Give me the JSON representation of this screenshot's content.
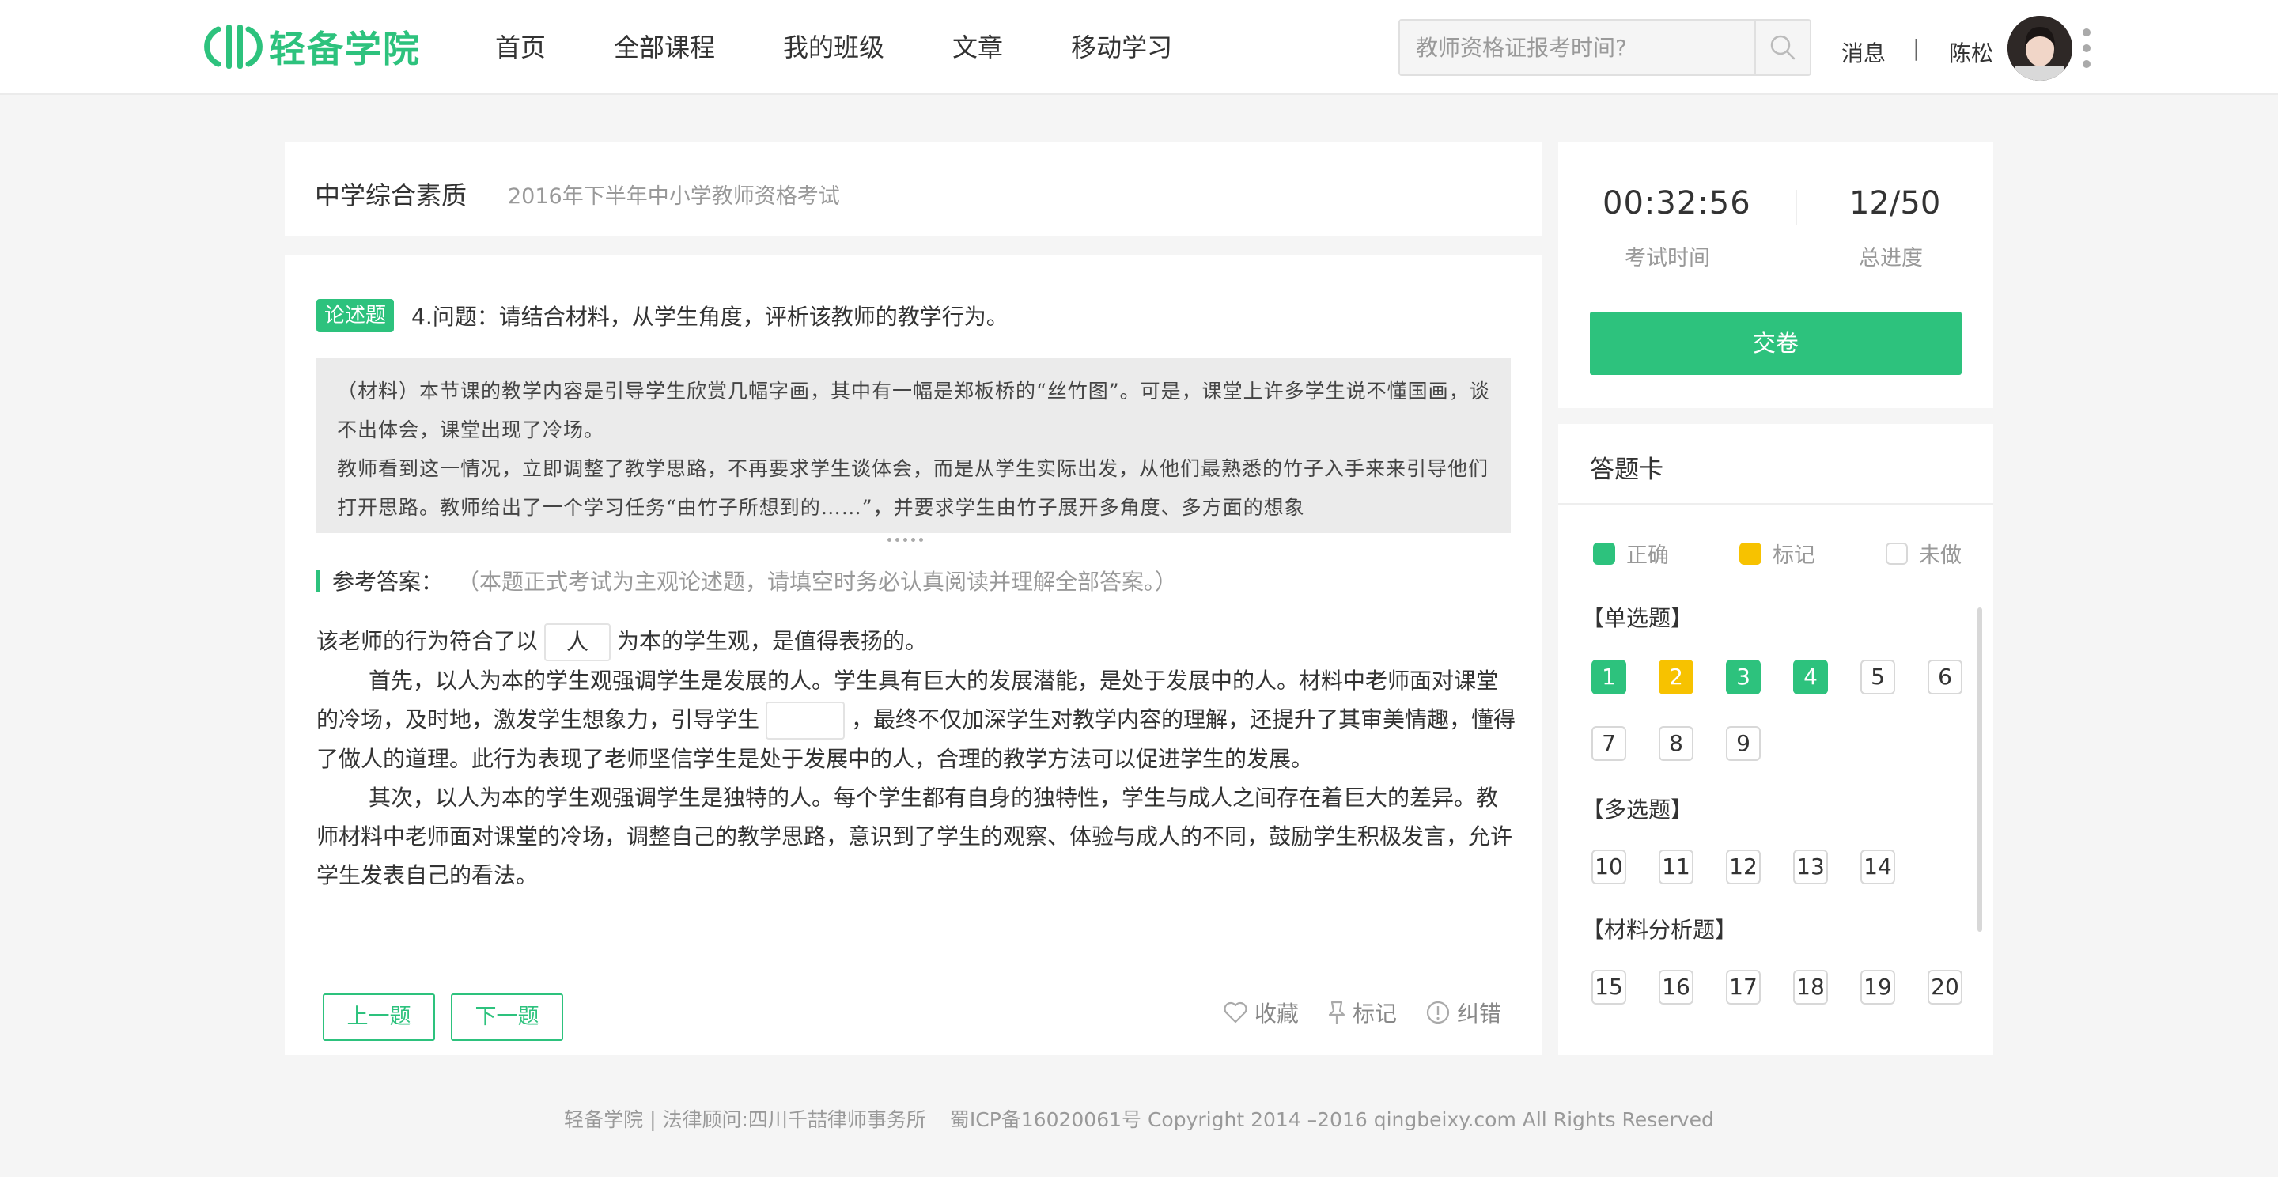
{
  "header": {
    "logo_text": "轻备学院",
    "nav": [
      "首页",
      "全部课程",
      "我的班级",
      "文章",
      "移动学习"
    ],
    "search_placeholder": "教师资格证报考时间?",
    "messages": "消息",
    "separator": "|",
    "username": "陈松"
  },
  "exam": {
    "subject": "中学综合素质",
    "exam_name": "2016年下半年中小学教师资格考试"
  },
  "question": {
    "tag": "论述题",
    "title": "4.问题：请结合材料，从学生角度，评析该教师的教学行为。",
    "material": [
      "（材料）本节课的教学内容是引导学生欣赏几幅字画，其中有一幅是郑板桥的“丝竹图”。可是，课堂上许多学生说不懂国画，谈不出体会，课堂出现了冷场。",
      "教师看到这一情况，立即调整了教学思路，不再要求学生谈体会，而是从学生实际出发，从他们最熟悉的竹子入手来来引导他们打开思路。教师给出了一个学习任务“由竹子所想到的……”，并要求学生由竹子展开多角度、多方面的想象"
    ],
    "ref_label": "参考答案：",
    "ref_note": "（本题正式考试为主观论述题，请填空时务必认真阅读并理解全部答案。）",
    "answer_p1_before": "该老师的行为符合了以",
    "blank1": "人",
    "answer_p1_after": "为本的学生观，是值得表扬的。",
    "answer_p2_before": "首先，以人为本的学生观强调学生是发展的人。学生具有巨大的发展潜能，是处于发展中的人。材料中老师面对课堂的冷场，及时地，激发学生想象力，引导学生",
    "blank2": "",
    "answer_p2_after": "，最终不仅加深学生对教学内容的理解，还提升了其审美情趣，懂得了做人的道理。此行为表现了老师坚信学生是处于发展中的人，合理的教学方法可以促进学生的发展。",
    "answer_p3": "其次，以人为本的学生观强调学生是独特的人。每个学生都有自身的独特性，学生与成人之间存在着巨大的差异。教师材料中老师面对课堂的冷场，调整自己的教学思路，意识到了学生的观察、体验与成人的不同，鼓励学生积极发言，允许学生发表自己的看法。",
    "prev": "上一题",
    "next": "下一题",
    "favorite": "收藏",
    "mark": "标记",
    "report": "纠错"
  },
  "timer": {
    "time": "00:32:56",
    "time_label": "考试时间",
    "progress": "12/50",
    "progress_label": "总进度",
    "submit": "交卷"
  },
  "answer_card": {
    "title": "答题卡",
    "legend": [
      {
        "label": "正确",
        "color": "#2dc27d"
      },
      {
        "label": "标记",
        "color": "#f7c200"
      },
      {
        "label": "未做",
        "color": "#ffffff"
      }
    ],
    "sections": [
      {
        "label": "【单选题】",
        "rows": [
          [
            {
              "n": "1",
              "s": "green"
            },
            {
              "n": "2",
              "s": "yellow"
            },
            {
              "n": "3",
              "s": "green"
            },
            {
              "n": "4",
              "s": "green"
            },
            {
              "n": "5",
              "s": ""
            },
            {
              "n": "6",
              "s": ""
            }
          ],
          [
            {
              "n": "7",
              "s": ""
            },
            {
              "n": "8",
              "s": ""
            },
            {
              "n": "9",
              "s": ""
            }
          ]
        ]
      },
      {
        "label": "【多选题】",
        "rows": [
          [
            {
              "n": "10",
              "s": ""
            },
            {
              "n": "11",
              "s": ""
            },
            {
              "n": "12",
              "s": ""
            },
            {
              "n": "13",
              "s": ""
            },
            {
              "n": "14",
              "s": ""
            }
          ]
        ]
      },
      {
        "label": "【材料分析题】",
        "rows": [
          [
            {
              "n": "15",
              "s": ""
            },
            {
              "n": "16",
              "s": ""
            },
            {
              "n": "17",
              "s": ""
            },
            {
              "n": "18",
              "s": ""
            },
            {
              "n": "19",
              "s": ""
            },
            {
              "n": "20",
              "s": ""
            }
          ]
        ]
      }
    ]
  },
  "footer": {
    "left": "轻备学院 | 法律顾问:四川千喆律师事务所",
    "right": "蜀ICP备16020061号 Copyright 2014 –2016 qingbeixy.com All Rights Reserved"
  },
  "colors": {
    "accent": "#2dc27d",
    "marked": "#f7c200"
  }
}
